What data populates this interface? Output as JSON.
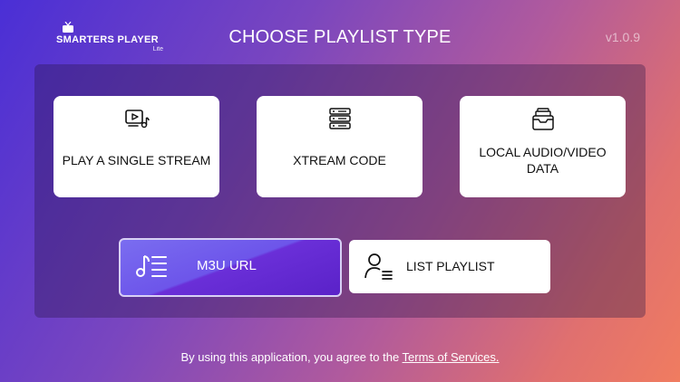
{
  "logo": {
    "name": "SMARTERS PLAYER",
    "edition": "Lite",
    "icon": "tv-icon"
  },
  "header": {
    "title": "CHOOSE PLAYLIST TYPE",
    "version": "v1.0.9"
  },
  "cards": [
    {
      "label": "PLAY A SINGLE STREAM",
      "icon": "video-play-icon"
    },
    {
      "label": "XTREAM CODE",
      "icon": "server-stack-icon"
    },
    {
      "label": "LOCAL AUDIO/VIDEO DATA",
      "icon": "file-box-icon"
    }
  ],
  "buttons": {
    "m3u": {
      "label": "M3U URL",
      "icon": "music-list-icon",
      "selected": true
    },
    "list": {
      "label": "LIST PLAYLIST",
      "icon": "user-list-icon"
    }
  },
  "footer": {
    "text": "By using this application, you agree to the ",
    "link": "Terms of Services."
  },
  "colors": {
    "selected_button": "#6a2fd8",
    "card_bg": "#ffffff"
  }
}
